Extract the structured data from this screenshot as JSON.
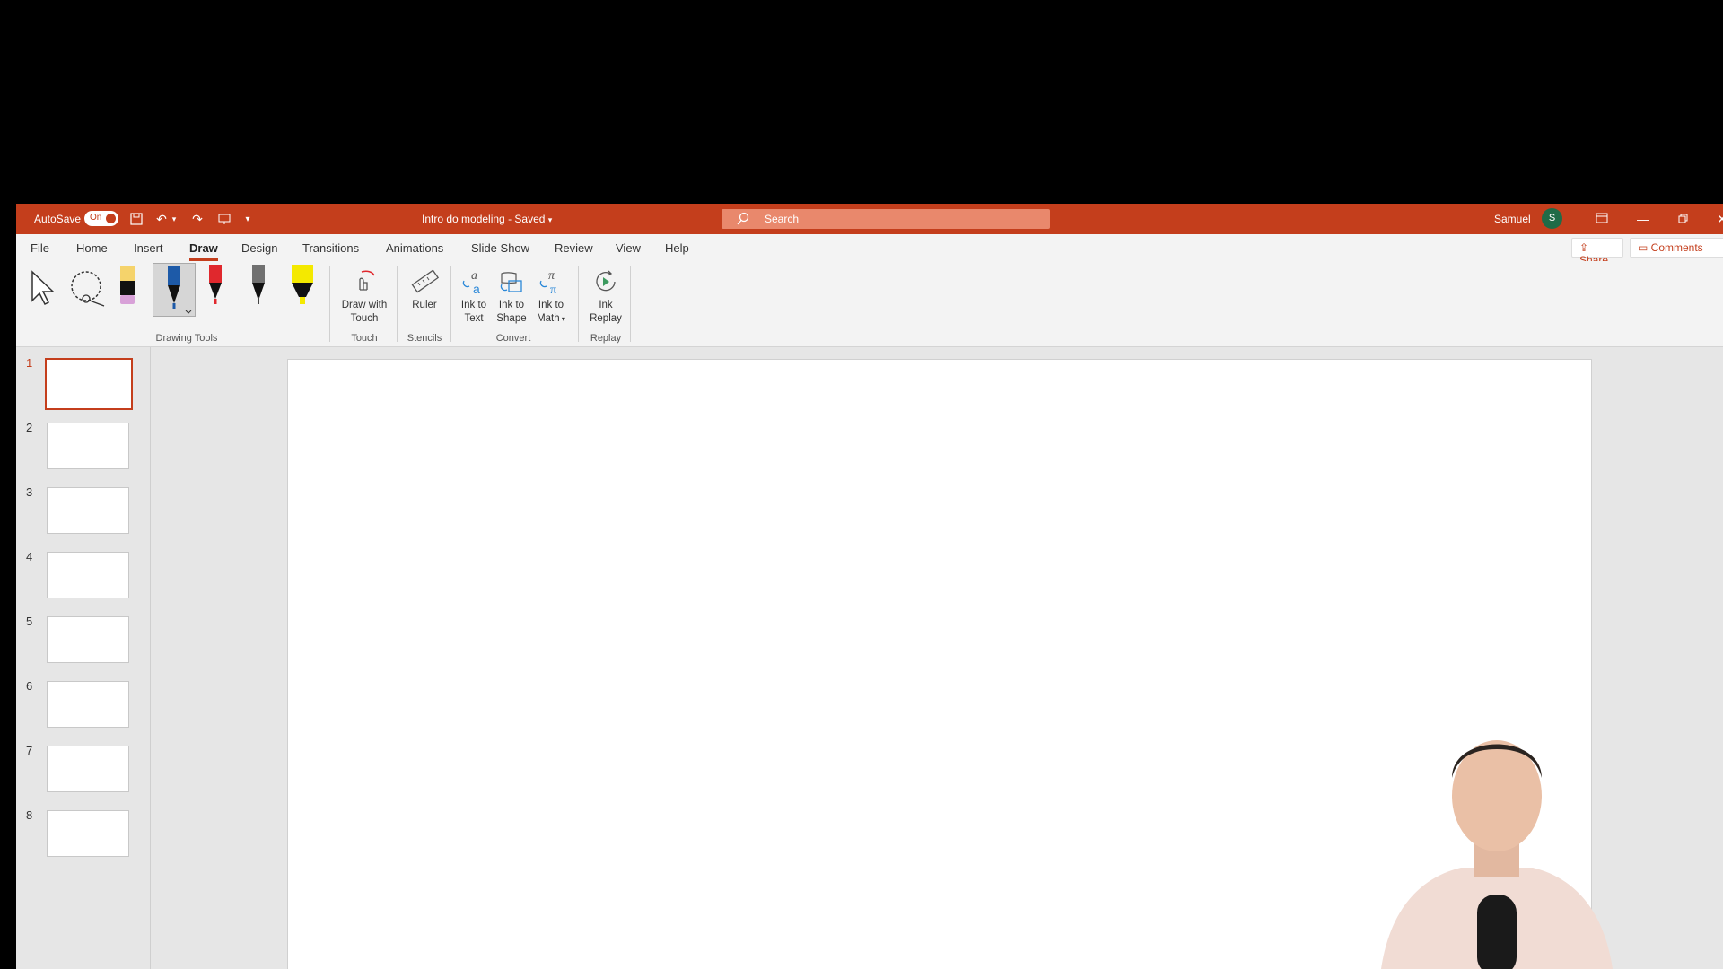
{
  "titlebar": {
    "autosave_label": "AutoSave",
    "autosave_state": "On",
    "doc_title": "Intro do modeling",
    "save_status": "Saved",
    "search_placeholder": "Search",
    "user_name": "Samuel",
    "user_initial": "S"
  },
  "tabs": [
    "File",
    "Home",
    "Insert",
    "Draw",
    "Design",
    "Transitions",
    "Animations",
    "Slide Show",
    "Review",
    "View",
    "Help"
  ],
  "active_tab": "Draw",
  "actions": {
    "share": "Share",
    "comments": "Comments"
  },
  "ribbon": {
    "groups": {
      "drawing_tools": "Drawing Tools",
      "touch": "Touch",
      "stencils": "Stencils",
      "convert": "Convert",
      "replay": "Replay"
    },
    "buttons": {
      "draw_with_touch_1": "Draw with",
      "draw_with_touch_2": "Touch",
      "ruler": "Ruler",
      "ink_to_text_1": "Ink to",
      "ink_to_text_2": "Text",
      "ink_to_shape_1": "Ink to",
      "ink_to_shape_2": "Shape",
      "ink_to_math_1": "Ink to",
      "ink_to_math_2": "Math",
      "ink_replay_1": "Ink",
      "ink_replay_2": "Replay"
    },
    "pen_colors": {
      "eraser_top": "#f5d36b",
      "blue_pen": "#1d5aa8",
      "red_pen": "#e0282d",
      "gray_pen": "#707070",
      "highlighter": "#f4e900"
    }
  },
  "slides": {
    "numbers": [
      "1",
      "2",
      "3",
      "4",
      "5",
      "6",
      "7",
      "8"
    ],
    "selected": "1"
  },
  "colors": {
    "accent": "#c43e1c"
  }
}
